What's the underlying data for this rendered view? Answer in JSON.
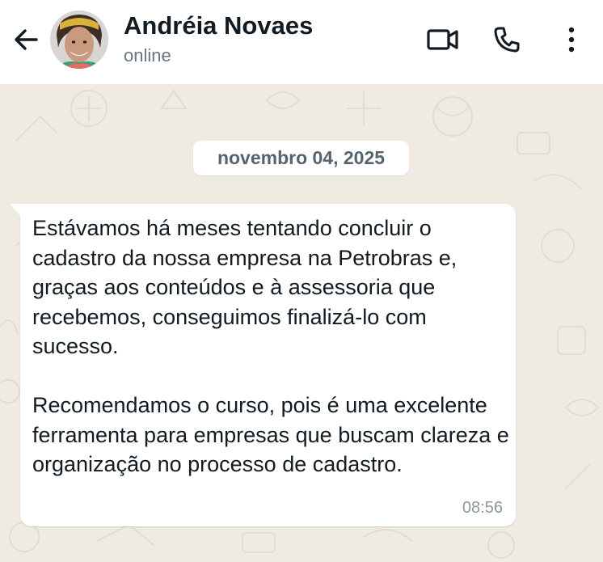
{
  "header": {
    "contact_name": "Andréia Novaes",
    "status": "online",
    "icons": [
      "back-arrow-icon",
      "video-call-icon",
      "phone-call-icon",
      "more-options-icon"
    ]
  },
  "chat": {
    "date_separator": "novembro 04, 2025",
    "messages": [
      {
        "direction": "incoming",
        "paragraphs": [
          "Estávamos há meses tentando concluir o cadastro da nossa empresa na Petrobras e, graças aos conteúdos e à assessoria que recebemos, conseguimos finalizá-lo com sucesso.",
          "Recomendamos o curso, pois é uma excelente ferramenta para empresas que buscam clareza e organização no processo de cadastro."
        ],
        "time": "08:56"
      }
    ]
  },
  "colors": {
    "chat_background": "#efeae2",
    "header_background": "#ffffff",
    "bubble_background": "#ffffff",
    "primary_text": "#111b21",
    "secondary_text": "#667781"
  }
}
